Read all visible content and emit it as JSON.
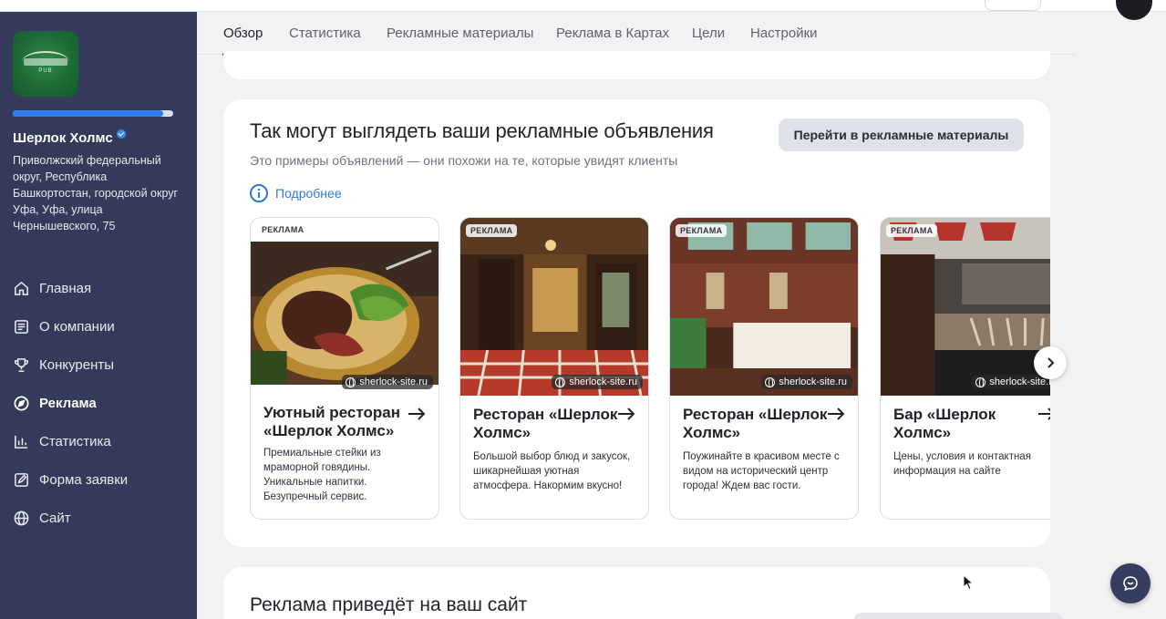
{
  "header": {},
  "sidebar": {
    "business_name": "Шерлок Холмс",
    "address": "Приволжский федеральный округ, Республика Башкортостан, городской округ Уфа, Уфа, улица Чернышевского, 75",
    "logo_text": "PUB",
    "profile_progress": 0.94,
    "nav": [
      {
        "label": "Главная",
        "icon": "home-icon"
      },
      {
        "label": "О компании",
        "icon": "document-icon"
      },
      {
        "label": "Конкуренты",
        "icon": "trophy-icon"
      },
      {
        "label": "Реклама",
        "icon": "compass-icon",
        "active": true
      },
      {
        "label": "Статистика",
        "icon": "bar-chart-icon"
      },
      {
        "label": "Форма заявки",
        "icon": "form-edit-icon"
      },
      {
        "label": "Сайт",
        "icon": "globe-icon"
      }
    ]
  },
  "tabs": [
    {
      "label": "Обзор",
      "active": true
    },
    {
      "label": "Статистика"
    },
    {
      "label": "Рекламные материалы"
    },
    {
      "label": "Реклама в Картах"
    },
    {
      "label": "Цели"
    },
    {
      "label": "Настройки"
    }
  ],
  "preview_section": {
    "title": "Так могут выглядеть ваши рекламные объявления",
    "subtitle": "Это примеры объявлений — они похожи на те, которые увидят клиенты",
    "more_link": "Подробнее",
    "button": "Перейти в рекламные материалы",
    "ads": [
      {
        "badge": "РЕКЛАМА",
        "site": "sherlock-site.ru",
        "title": "Уютный ресторан «Шерлок Холмс»",
        "description": "Премиальные стейки из мраморной говядины. Уникальные напитки. Безупречный сервис.",
        "image": "steak-photo"
      },
      {
        "badge": "РЕКЛАМА",
        "site": "sherlock-site.ru",
        "title": "Ресторан «Шерлок Холмс»",
        "description": "Большой выбор блюд и закусок, шикарнейшая уютная атмосфера. Накормим вкусно!",
        "image": "restaurant-interior-photo"
      },
      {
        "badge": "РЕКЛАМА",
        "site": "sherlock-site.ru",
        "title": "Ресторан «Шерлок Холмс»",
        "description": "Поужинайте в красивом месте с видом на исторический центр города! Ждем вас гости.",
        "image": "dining-room-photo"
      },
      {
        "badge": "РЕКЛАМА",
        "site": "sherlock-site.ru",
        "title": "Бар «Шерлок Холмс»",
        "description": "Цены, условия и контактная информация на сайте",
        "image": "bar-photo"
      }
    ]
  },
  "site_section": {
    "title": "Реклама приведёт на ваш сайт"
  },
  "colors": {
    "sidebar_bg": "#353a5a",
    "accent_blue": "#2e78d8",
    "page_bg": "#f1f2f4"
  }
}
